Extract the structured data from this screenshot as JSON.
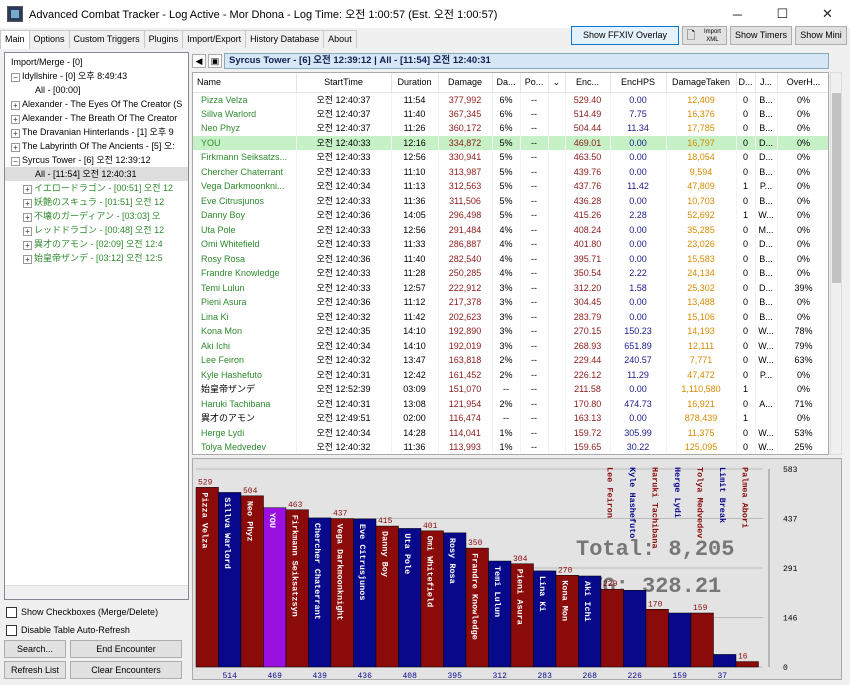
{
  "window": {
    "title": "Advanced Combat Tracker - Log Active - Mor Dhona - Log Time: 오전 1:00:57 (Est. 오전 1:00:57)",
    "minimize": "─",
    "maximize": "☐",
    "close": "✕"
  },
  "tabs": [
    "Main",
    "Options",
    "Custom Triggers",
    "Plugins",
    "Import/Export",
    "History Database",
    "About"
  ],
  "top_buttons": {
    "overlay": "Show FFXIV Overlay",
    "import_xml": "Import XML",
    "timers": "Show Timers",
    "mini": "Show Mini"
  },
  "tree": [
    {
      "label": "Import/Merge - [0]",
      "level": 0,
      "exp": "",
      "color": "black"
    },
    {
      "label": "Idyllshire - [0] 오후 8:49:43",
      "level": 0,
      "exp": "−",
      "color": "black"
    },
    {
      "label": "All - [00:00]",
      "level": 2,
      "exp": "",
      "color": "black"
    },
    {
      "label": "Alexander - The Eyes Of The Creator (S",
      "level": 0,
      "exp": "+",
      "color": "black"
    },
    {
      "label": "Alexander - The Breath Of The Creator",
      "level": 0,
      "exp": "+",
      "color": "black"
    },
    {
      "label": "The Dravanian Hinterlands - [1] 오후 9",
      "level": 0,
      "exp": "+",
      "color": "black"
    },
    {
      "label": "The Labyrinth Of The Ancients - [5] 오:",
      "level": 0,
      "exp": "+",
      "color": "black"
    },
    {
      "label": "Syrcus Tower - [6] 오전 12:39:12",
      "level": 0,
      "exp": "−",
      "color": "black"
    },
    {
      "label": "All - [11:54] 오전 12:40:31",
      "level": 2,
      "exp": "",
      "color": "black",
      "selected": true
    },
    {
      "label": "イエロードラゴン - [00:51] 오전 12",
      "level": 1,
      "exp": "+",
      "color": "green"
    },
    {
      "label": "妖艶のスキュラ - [01:51] 오전 12",
      "level": 1,
      "exp": "+",
      "color": "green"
    },
    {
      "label": "不壊のガーディアン - [03:03] 오",
      "level": 1,
      "exp": "+",
      "color": "green"
    },
    {
      "label": "レッドドラゴン - [00:48] 오전 12",
      "level": 1,
      "exp": "+",
      "color": "green"
    },
    {
      "label": "異才のアモン - [02:09] 오전 12:4",
      "level": 1,
      "exp": "+",
      "color": "green"
    },
    {
      "label": "始皇帝ザンデ - [03:12] 오전 12:5",
      "level": 1,
      "exp": "+",
      "color": "green"
    }
  ],
  "checkboxes": {
    "show": "Show Checkboxes (Merge/Delete)",
    "disable": "Disable Table Auto-Refresh"
  },
  "left_buttons": {
    "search": "Search...",
    "end": "End Encounter",
    "refresh": "Refresh List",
    "clear": "Clear Encounters"
  },
  "encounter_title": "Syrcus Tower - [6] 오전 12:39:12  |  All - [11:54] 오전 12:40:31",
  "nav": {
    "back": "◀",
    "icon": "▣"
  },
  "columns": [
    "Name",
    "StartTime",
    "Duration",
    "Damage",
    "Da...",
    "Po...",
    "⌄",
    "Enc...",
    "EncHPS",
    "DamageTaken",
    "D...",
    "J...",
    "OverH..."
  ],
  "rows": [
    [
      "Pizza Velza",
      "오전 12:40:37",
      "11:54",
      "377,992",
      "6%",
      "--",
      "",
      "529.40",
      "0.00",
      "12,409",
      "0",
      "B...",
      "0%"
    ],
    [
      "Sillva Warlord",
      "오전 12:40:37",
      "11:40",
      "367,345",
      "6%",
      "--",
      "",
      "514.49",
      "7.75",
      "16,376",
      "0",
      "B...",
      "0%"
    ],
    [
      "Neo Phyz",
      "오전 12:40:37",
      "11:26",
      "360,172",
      "6%",
      "--",
      "",
      "504.44",
      "11.34",
      "17,785",
      "0",
      "B...",
      "0%"
    ],
    [
      "YOU",
      "오전 12:40:33",
      "12:16",
      "334,872",
      "5%",
      "--",
      "",
      "469.01",
      "0.00",
      "16,797",
      "0",
      "D...",
      "0%"
    ],
    [
      "Firkmann Seiksatzs...",
      "오전 12:40:33",
      "12:56",
      "330,941",
      "5%",
      "--",
      "",
      "463.50",
      "0.00",
      "18,054",
      "0",
      "D...",
      "0%"
    ],
    [
      "Chercher Chaterrant",
      "오전 12:40:33",
      "11:10",
      "313,987",
      "5%",
      "--",
      "",
      "439.76",
      "0.00",
      "9,594",
      "0",
      "B...",
      "0%"
    ],
    [
      "Vega Darkmoonkni...",
      "오전 12:40:34",
      "11:13",
      "312,563",
      "5%",
      "--",
      "",
      "437.76",
      "11.42",
      "47,809",
      "1",
      "P...",
      "0%"
    ],
    [
      "Eve Citrusjunos",
      "오전 12:40:33",
      "11:36",
      "311,506",
      "5%",
      "--",
      "",
      "436.28",
      "0.00",
      "10,703",
      "0",
      "B...",
      "0%"
    ],
    [
      "Danny Boy",
      "오전 12:40:36",
      "14:05",
      "296,498",
      "5%",
      "--",
      "",
      "415.26",
      "2.28",
      "52,692",
      "1",
      "W...",
      "0%"
    ],
    [
      "Uta Pole",
      "오전 12:40:33",
      "12:56",
      "291,484",
      "4%",
      "--",
      "",
      "408.24",
      "0.00",
      "35,285",
      "0",
      "M...",
      "0%"
    ],
    [
      "Omi Whitefield",
      "오전 12:40:33",
      "11:33",
      "286,887",
      "4%",
      "--",
      "",
      "401.80",
      "0.00",
      "23,026",
      "0",
      "D...",
      "0%"
    ],
    [
      "Rosy Rosa",
      "오전 12:40:36",
      "11:40",
      "282,540",
      "4%",
      "--",
      "",
      "395.71",
      "0.00",
      "15,583",
      "0",
      "B...",
      "0%"
    ],
    [
      "Frandre Knowledge",
      "오전 12:40:33",
      "11:28",
      "250,285",
      "4%",
      "--",
      "",
      "350.54",
      "2.22",
      "24,134",
      "0",
      "B...",
      "0%"
    ],
    [
      "Temi Lulun",
      "오전 12:40:33",
      "12:57",
      "222,912",
      "3%",
      "--",
      "",
      "312.20",
      "1.58",
      "25,302",
      "0",
      "D...",
      "39%"
    ],
    [
      "Pieni Asura",
      "오전 12:40:36",
      "11:12",
      "217,378",
      "3%",
      "--",
      "",
      "304.45",
      "0.00",
      "13,488",
      "0",
      "B...",
      "0%"
    ],
    [
      "Lina Ki",
      "오전 12:40:32",
      "11:42",
      "202,623",
      "3%",
      "--",
      "",
      "283.79",
      "0.00",
      "15,106",
      "0",
      "B...",
      "0%"
    ],
    [
      "Kona Mon",
      "오전 12:40:35",
      "14:10",
      "192,890",
      "3%",
      "--",
      "",
      "270.15",
      "150.23",
      "14,193",
      "0",
      "W...",
      "78%"
    ],
    [
      "Aki Ichi",
      "오전 12:40:34",
      "14:10",
      "192,019",
      "3%",
      "--",
      "",
      "268.93",
      "651.89",
      "12,111",
      "0",
      "W...",
      "79%"
    ],
    [
      "Lee Feiron",
      "오전 12:40:32",
      "13:47",
      "163,818",
      "2%",
      "--",
      "",
      "229.44",
      "240.57",
      "7,771",
      "0",
      "W...",
      "63%"
    ],
    [
      "Kyle Hashefuto",
      "오전 12:40:31",
      "12:42",
      "161,452",
      "2%",
      "--",
      "",
      "226.12",
      "11.29",
      "47,472",
      "0",
      "P...",
      "0%"
    ],
    [
      "始皇帝ザンデ",
      "오전 12:52:39",
      "03:09",
      "151,070",
      "--",
      "--",
      "",
      "211.58",
      "0.00",
      "1,110,580",
      "1",
      "",
      "0%"
    ],
    [
      "Haruki Tachibana",
      "오전 12:40:31",
      "13:08",
      "121,954",
      "2%",
      "--",
      "",
      "170.80",
      "474.73",
      "16,921",
      "0",
      "A...",
      "71%"
    ],
    [
      "異才のアモン",
      "오전 12:49:51",
      "02:00",
      "116,474",
      "--",
      "--",
      "",
      "163.13",
      "0.00",
      "878,439",
      "1",
      "",
      "0%"
    ],
    [
      "Herge Lydi",
      "오전 12:40:34",
      "14:28",
      "114,041",
      "1%",
      "--",
      "",
      "159.72",
      "305.99",
      "11,375",
      "0",
      "W...",
      "53%"
    ],
    [
      "Tolya Medvedev",
      "오전 12:40:32",
      "11:36",
      "113,993",
      "1%",
      "--",
      "",
      "159.65",
      "30.22",
      "125,095",
      "0",
      "W...",
      "25%"
    ]
  ],
  "chart_data": {
    "type": "bar",
    "categories": [
      "Pizza Velza",
      "Sillva Warlord",
      "Neo Phyz",
      "YOU",
      "Firkmann Seiksatzsyn",
      "Chercher Chaterrant",
      "Vega Darkmoonknight",
      "Eve Citrusjunos",
      "Danny Boy",
      "Uta Pole",
      "Omi Whitefield",
      "Rosy Rosa",
      "Frandre Knowledge",
      "Temi Lulun",
      "Pieni Asura",
      "Lina Ki",
      "Kona Mon",
      "Aki Ichi",
      "Lee Feiron",
      "Kyle Hashefuto",
      "Haruki Tachibana",
      "Herge Lydi",
      "Tolya Medvedev",
      "Limit Break",
      "Palmea Abori"
    ],
    "values": [
      529,
      514,
      504,
      469,
      463,
      439,
      437,
      436,
      415,
      408,
      401,
      395,
      350,
      312,
      304,
      283,
      270,
      268,
      229,
      226,
      170,
      159,
      159,
      37,
      16
    ],
    "top_labels": [
      "529",
      "",
      "504",
      "",
      "463",
      "",
      "437",
      "",
      "415",
      "",
      "401",
      "",
      "350",
      "",
      "304",
      "",
      "270",
      "",
      "229",
      "",
      "170",
      "",
      "159",
      "",
      "16"
    ],
    "bottom_labels": [
      "",
      "514",
      "",
      "469",
      "",
      "439",
      "",
      "436",
      "",
      "408",
      "",
      "395",
      "",
      "312",
      "",
      "283",
      "",
      "268",
      "",
      "226",
      "",
      "159",
      "",
      "37",
      ""
    ],
    "bar_colors": [
      "#8b0a0a",
      "#08088b",
      "#8b0a0a",
      "#9a10e0",
      "#8b0a0a",
      "#08088b",
      "#8b0a0a",
      "#08088b",
      "#8b0a0a",
      "#08088b",
      "#8b0a0a",
      "#08088b",
      "#8b0a0a",
      "#08088b",
      "#8b0a0a",
      "#08088b",
      "#8b0a0a",
      "#08088b",
      "#8b0a0a",
      "#08088b",
      "#8b0a0a",
      "#08088b",
      "#8b0a0a",
      "#08088b",
      "#8b0a0a"
    ],
    "ylim": [
      0,
      583
    ],
    "yticks": [
      "583",
      "437",
      "291",
      "146",
      "0"
    ],
    "total_label": "Total: 8,205",
    "avg_label": "AVG: 328.21"
  }
}
